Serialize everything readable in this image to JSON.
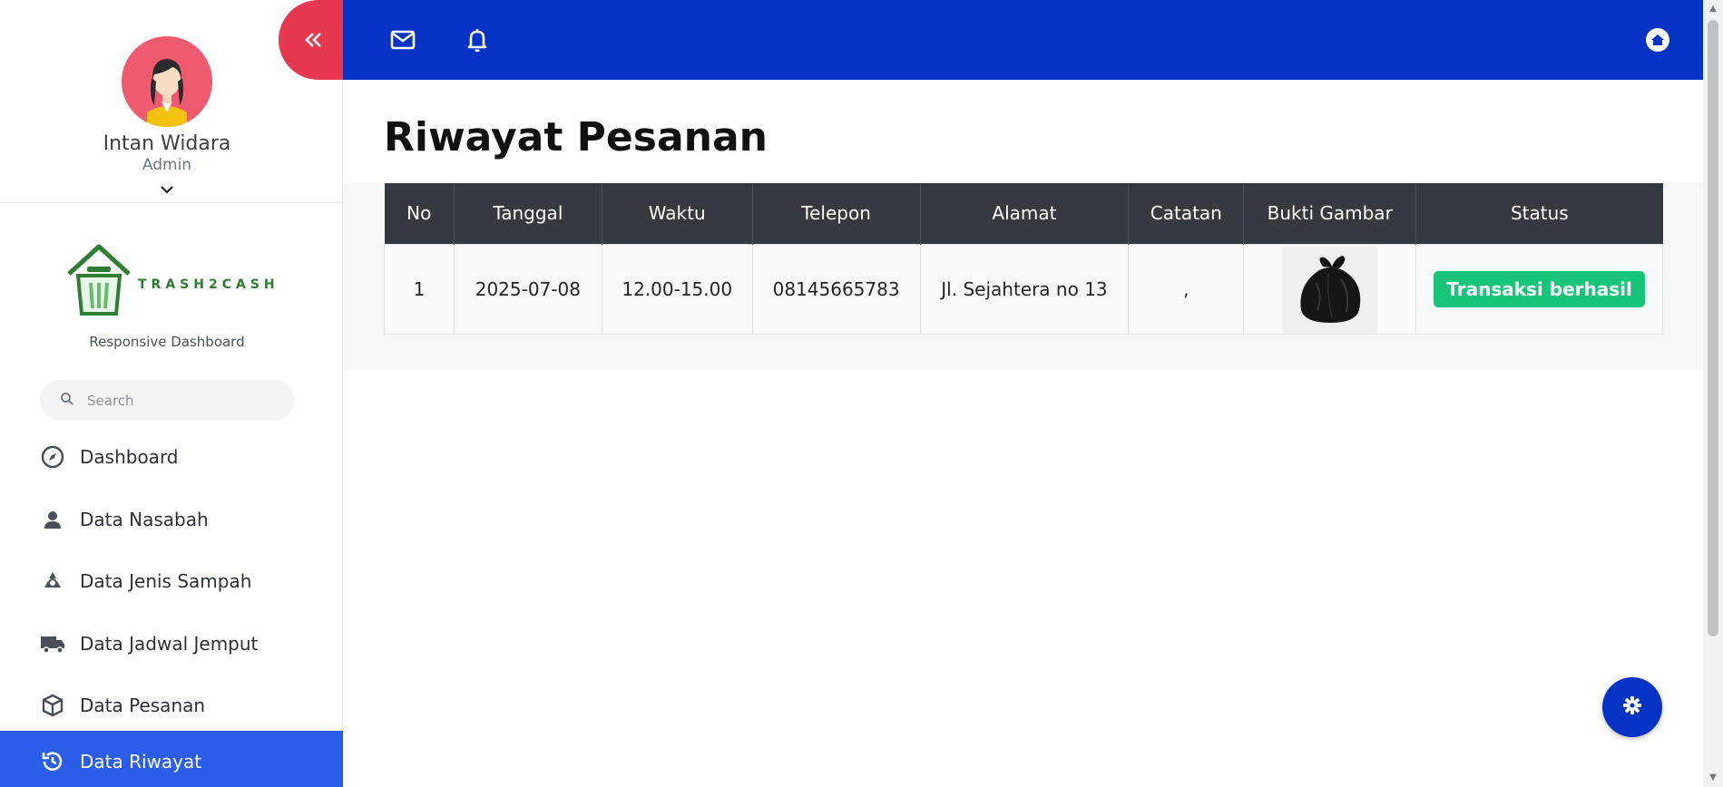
{
  "profile": {
    "name": "Intan Widara",
    "role": "Admin"
  },
  "brand": {
    "name": "TRASH2CASH",
    "subtitle": "Responsive Dashboard"
  },
  "search": {
    "placeholder": "Search"
  },
  "sidebar": {
    "items": [
      {
        "label": "Dashboard",
        "icon": "compass-icon"
      },
      {
        "label": "Data Nasabah",
        "icon": "user-icon"
      },
      {
        "label": "Data Jenis Sampah",
        "icon": "recycle-icon"
      },
      {
        "label": "Data Jadwal Jemput",
        "icon": "truck-icon"
      },
      {
        "label": "Data Pesanan",
        "icon": "box-icon"
      },
      {
        "label": "Data Riwayat",
        "icon": "history-icon",
        "active": true
      }
    ]
  },
  "page": {
    "title": "Riwayat Pesanan"
  },
  "table": {
    "headers": [
      "No",
      "Tanggal",
      "Waktu",
      "Telepon",
      "Alamat",
      "Catatan",
      "Bukti Gambar",
      "Status"
    ],
    "rows": [
      {
        "no": "1",
        "tanggal": "2025-07-08",
        "waktu": "12.00-15.00",
        "telepon": "08145665783",
        "alamat": "Jl. Sejahtera no 13",
        "catatan": ",",
        "bukti": "trash-bag-image",
        "status": "Transaksi berhasil"
      }
    ]
  },
  "colors": {
    "topbar": "#0433c6",
    "active_nav": "#2b5ee8",
    "collapse": "#e63950",
    "success": "#16c47a",
    "table_header": "#343a40"
  }
}
